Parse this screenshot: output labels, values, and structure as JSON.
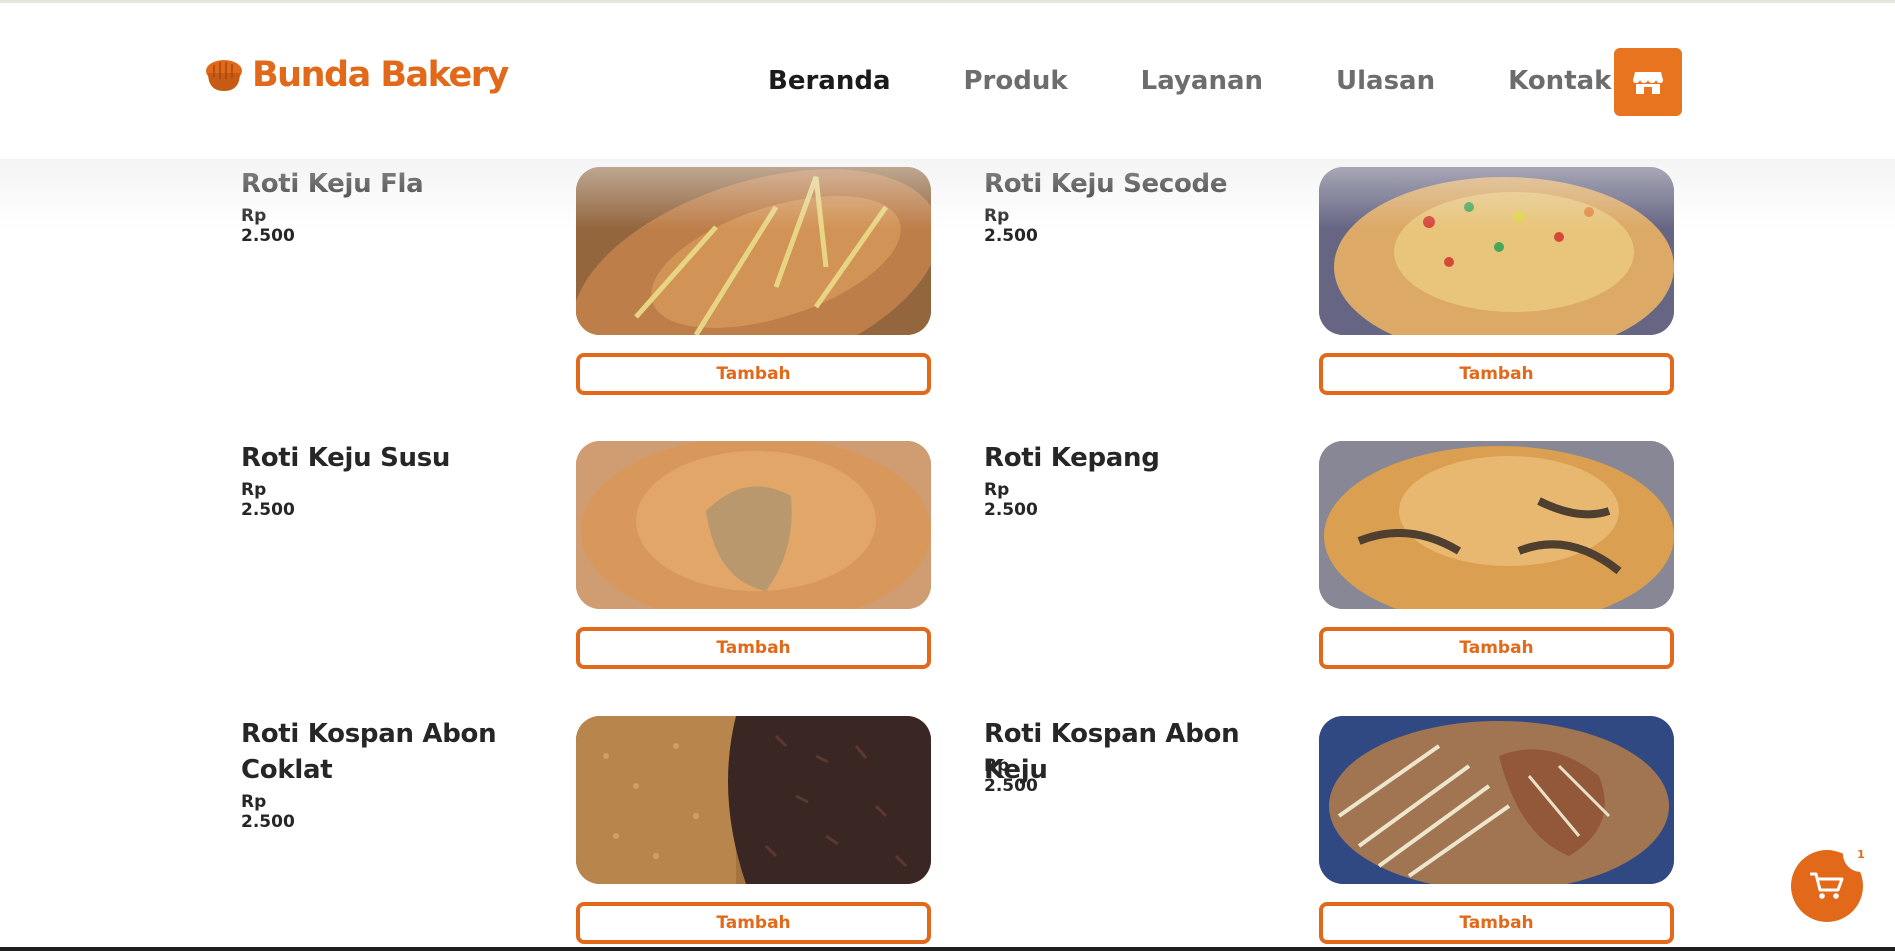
{
  "brand": {
    "name": "Bunda Bakery",
    "accent": "#e2691a"
  },
  "nav": {
    "items": [
      {
        "label": "Beranda",
        "active": true
      },
      {
        "label": "Produk",
        "active": false
      },
      {
        "label": "Layanan",
        "active": false
      },
      {
        "label": "Ulasan",
        "active": false
      },
      {
        "label": "Kontak",
        "active": false
      }
    ],
    "store_icon": "store-icon"
  },
  "products": [
    {
      "name": "Roti Keju Fla",
      "price": "Rp 2.500",
      "button": "Tambah"
    },
    {
      "name": "Roti Keju Secode",
      "price": "Rp 2.500",
      "button": "Tambah"
    },
    {
      "name": "Roti Keju Susu",
      "price": "Rp 2.500",
      "button": "Tambah"
    },
    {
      "name": "Roti Kepang",
      "price": "Rp 2.500",
      "button": "Tambah"
    },
    {
      "name": "Roti Kospan Abon Coklat",
      "price": "Rp 2.500",
      "button": "Tambah"
    },
    {
      "name": "Roti Kospan Abon Keju",
      "price": "Rp 2.500",
      "button": "Tambah"
    }
  ],
  "cart": {
    "count": "1",
    "icon": "cart-icon"
  }
}
